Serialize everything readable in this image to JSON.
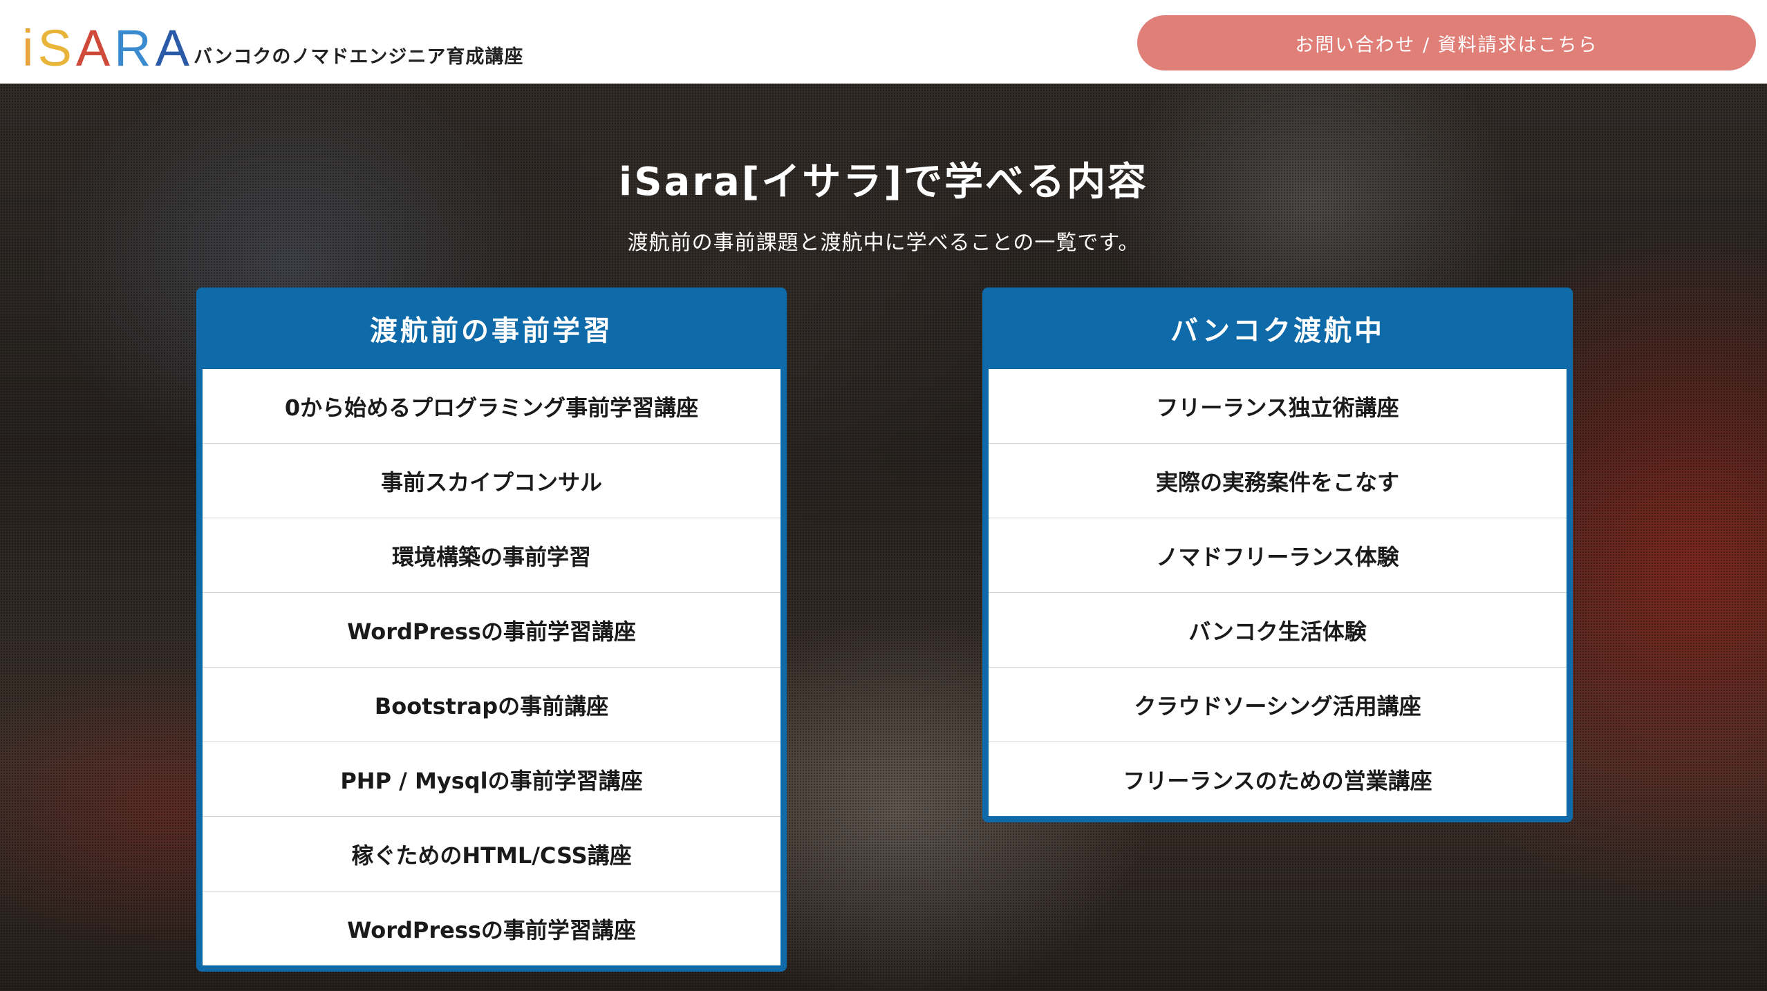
{
  "header": {
    "logo_letters": [
      {
        "char": "i",
        "color": "#e8a33a"
      },
      {
        "char": "S",
        "color": "#e8b43a"
      },
      {
        "char": "A",
        "color": "#d04a3a"
      },
      {
        "char": "R",
        "color": "#3a8ad0"
      },
      {
        "char": "A",
        "color": "#2a5aa8"
      }
    ],
    "tagline": "バンコクのノマドエンジニア育成講座",
    "contact_button": "お問い合わせ / 資料請求はこちら"
  },
  "hero": {
    "title": "iSara[イサラ]で学べる内容",
    "subtitle": "渡航前の事前課題と渡航中に学べることの一覧です。"
  },
  "panels": {
    "pre": {
      "title": "渡航前の事前学習",
      "items": [
        "0から始めるプログラミング事前学習講座",
        "事前スカイプコンサル",
        "環境構築の事前学習",
        "WordPressの事前学習講座",
        "Bootstrapの事前講座",
        "PHP / Mysqlの事前学習講座",
        "稼ぐためのHTML/CSS講座",
        "WordPressの事前学習講座"
      ]
    },
    "during": {
      "title": "バンコク渡航中",
      "items": [
        "フリーランス独立術講座",
        "実際の実務案件をこなす",
        "ノマドフリーランス体験",
        "バンコク生活体験",
        "クラウドソーシング活用講座",
        "フリーランスのための営業講座"
      ]
    }
  },
  "colors": {
    "panel_blue": "#0e6aa8",
    "button_salmon": "#e07f78"
  }
}
